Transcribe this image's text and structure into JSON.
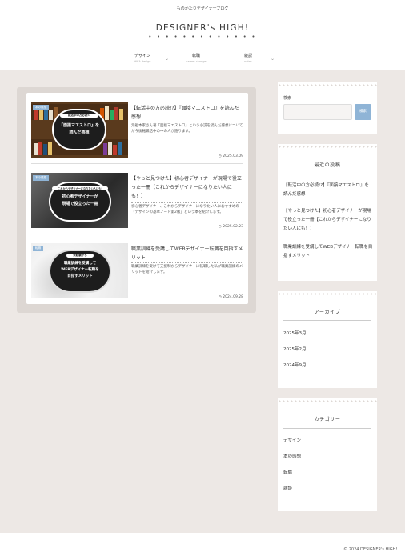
{
  "header": {
    "tagline": "ものかたりデザイナーブログ",
    "site_title": "DESIGNER's HIGH!",
    "title_dots": "• • • • • • • • •   • • • •",
    "nav": [
      {
        "label": "デザイン",
        "sub": "HIKA design"
      },
      {
        "label": "転職",
        "sub": "career change"
      },
      {
        "label": "雑記",
        "sub": "notes"
      }
    ]
  },
  "posts": [
    {
      "category": "本の感想",
      "thumb_badge": "就活中の方必読!?",
      "thumb_caption_1": "『面接マエストロ』を",
      "thumb_caption_2": "読んだ感想",
      "title": "【転活中の方必読!?】『面接マエストロ』を読んだ感想",
      "excerpt": "元祖本家さん著「面接マエストロ」という小説を読んだ感想についてだ今後転職活中の中の人が語ります。",
      "date": "2025.03.09"
    },
    {
      "category": "本の感想",
      "thumb_badge": "これからデザイナーになりたい人にも!",
      "thumb_caption_1": "初心者デザイナーが",
      "thumb_caption_2": "現場で役立った一冊",
      "title": "【やっと見つけた】初心者デザイナーが現場で役立った一冊【これからデザイナーになりたい人にも！】",
      "excerpt": "初心者デザイナー、これからデザイナーになりたい人におすすめの「デザインの基本ノート第2版」という本を紹介します。",
      "date": "2025.02.23"
    },
    {
      "category": "転職",
      "thumb_badge": "未経験から",
      "thumb_caption_1": "職業訓練を受講して",
      "thumb_caption_2": "WEBデザイナー転職を",
      "thumb_caption_3": "目指すメリット",
      "title": "職業訓練を受講してWEBデザイナー転職を目指すメリット",
      "excerpt": "職業訓練を受けて支援制からデザイナーに転職した私が職業訓練のメリットを紹介します。",
      "date": "2024.09.28"
    }
  ],
  "sidebar": {
    "search": {
      "label": "検索",
      "button": "検索",
      "placeholder": ""
    },
    "recent": {
      "heading": "最近の投稿",
      "items": [
        "【転活中の方必読!?】『面接マエストロ』を読んだ感想",
        "【やっと見つけた】初心者デザイナーが現場で役立った一冊【これからデザイナーになりたい人にも！】",
        "職業訓練を受講してWEBデザイナー転職を目指すメリット"
      ]
    },
    "archive": {
      "heading": "アーカイブ",
      "items": [
        "2025年3月",
        "2025年2月",
        "2024年9月"
      ]
    },
    "categories": {
      "heading": "カテゴリー",
      "items": [
        "デザイン",
        "本の感想",
        "転職",
        "雑談"
      ]
    }
  },
  "footer": {
    "copyright": "© 2024 DESIGNER's HIGH!."
  },
  "colors": {
    "accent": "#8fb4d6",
    "background": "#ede8e5"
  }
}
